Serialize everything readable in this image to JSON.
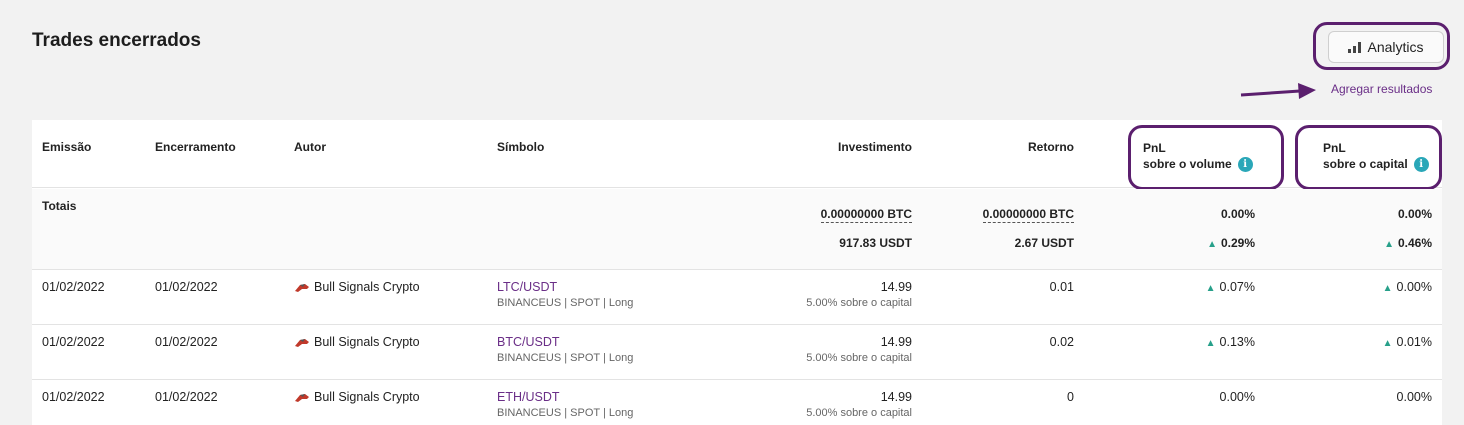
{
  "page": {
    "title": "Trades encerrados",
    "analytics_label": "Analytics",
    "aggregate_label": "Agregar resultados"
  },
  "columns": {
    "emissao": "Emissão",
    "encerramento": "Encerramento",
    "autor": "Autor",
    "simbolo": "Símbolo",
    "investimento": "Investimento",
    "retorno": "Retorno",
    "pnl_volume_line1": "PnL",
    "pnl_volume_line2": "sobre o volume",
    "pnl_capital_line1": "PnL",
    "pnl_capital_line2": "sobre o capital"
  },
  "totals": {
    "label": "Totais",
    "investimento_btc": "0.00000000 BTC",
    "investimento_usdt": "917.83 USDT",
    "retorno_btc": "0.00000000 BTC",
    "retorno_usdt": "2.67 USDT",
    "pnl_volume_1": "0.00%",
    "pnl_volume_2": "0.29%",
    "pnl_capital_1": "0.00%",
    "pnl_capital_2": "0.46%"
  },
  "rows": [
    {
      "emissao": "01/02/2022",
      "encerramento": "01/02/2022",
      "autor": "Bull Signals Crypto",
      "simbolo": "LTC/USDT",
      "simbolo_detail": "BINANCEUS | SPOT | Long",
      "investimento": "14.99",
      "investimento_detail": "5.00% sobre o capital",
      "retorno": "0.01",
      "pnl_volume": "0.07%",
      "pnl_capital": "0.00%"
    },
    {
      "emissao": "01/02/2022",
      "encerramento": "01/02/2022",
      "autor": "Bull Signals Crypto",
      "simbolo": "BTC/USDT",
      "simbolo_detail": "BINANCEUS | SPOT | Long",
      "investimento": "14.99",
      "investimento_detail": "5.00% sobre o capital",
      "retorno": "0.02",
      "pnl_volume": "0.13%",
      "pnl_capital": "0.01%"
    },
    {
      "emissao": "01/02/2022",
      "encerramento": "01/02/2022",
      "autor": "Bull Signals Crypto",
      "simbolo": "ETH/USDT",
      "simbolo_detail": "BINANCEUS | SPOT | Long",
      "investimento": "14.99",
      "investimento_detail": "5.00% sobre o capital",
      "retorno": "0",
      "pnl_volume": "0.00%",
      "pnl_capital": "0.00%"
    }
  ],
  "icons": {
    "info": "info-icon",
    "up": "triangle-up-icon",
    "analytics": "bar-chart-icon",
    "author": "bull-icon"
  },
  "colors": {
    "accent": "#6a2e87",
    "highlight": "#5b1f6e",
    "up": "#27a08a",
    "info": "#2aa7b8"
  }
}
